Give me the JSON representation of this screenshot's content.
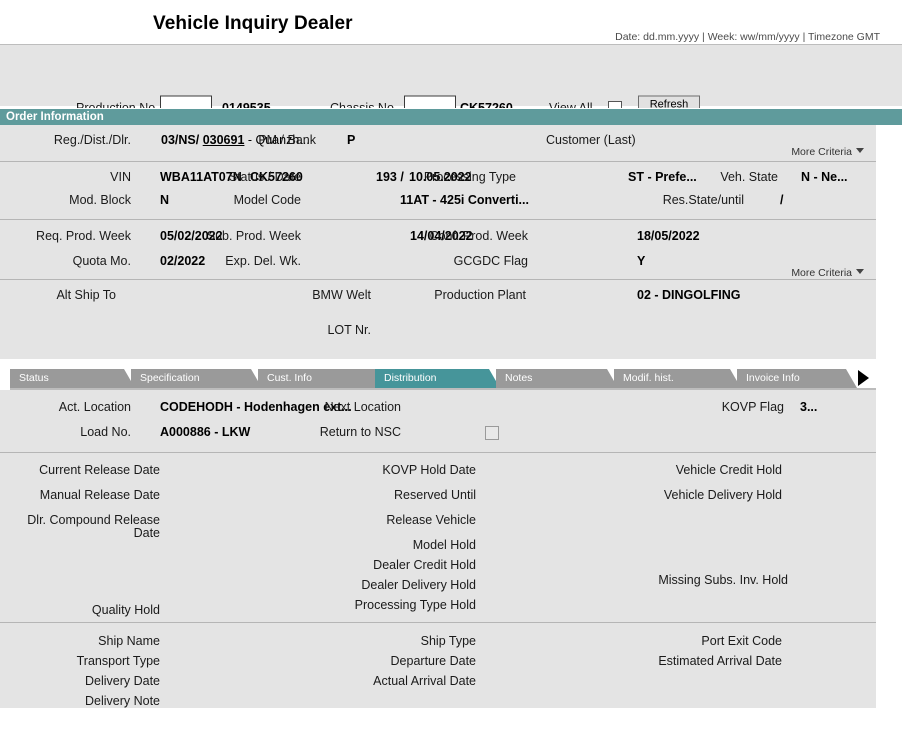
{
  "header": {
    "title": "Vehicle Inquiry Dealer",
    "meta": "Date: dd.mm.yyyy | Week: ww/mm/yyyy | Timezone GMT"
  },
  "search": {
    "production_no_label": "Production No.",
    "production_no_input": "",
    "production_no_value": "0149535",
    "chassis_no_label": "Chassis No.",
    "chassis_no_input": "",
    "chassis_no_value": "CK57260",
    "view_all_label": "View All",
    "view_all_checked": false,
    "refresh_label": "Refresh"
  },
  "order_information": {
    "section_title": "Order Information",
    "more_criteria_label": "More Criteria",
    "row1": {
      "reg_dist_dlr_label": "Reg./Dist./Dlr.",
      "reg_dist_dlr_prefix": "03/NS/",
      "reg_dist_dlr_link": "030691",
      "reg_dist_dlr_suffix": "- Quanzh...",
      "pm_bank_label": "PM / Bank",
      "pm_bank_value": "P",
      "customer_last_label": "Customer (Last)",
      "customer_last_value": ""
    },
    "row2": {
      "vin_label": "VIN",
      "vin_value": "WBA11AT07N",
      "vin_chassis": "CK57260",
      "status_date_label": "Status / Date",
      "status_value": "193 /",
      "status_date_value": "10.05.2022",
      "processing_type_label": "Processing Type",
      "processing_type_value": "ST - Prefe...",
      "veh_state_label": "Veh. State",
      "veh_state_value": "N - Ne..."
    },
    "row3": {
      "mod_block_label": "Mod. Block",
      "mod_block_value": "N",
      "model_code_label": "Model Code",
      "model_code_value": "11AT - 425i Converti...",
      "res_state_label": "Res.State/until",
      "res_state_value": "/"
    },
    "row4": {
      "req_prod_week_label": "Req. Prod. Week",
      "req_prod_week_value": "05/02/2022",
      "sub_prod_week_label": "Sub. Prod. Week",
      "sub_prod_week_value": "14/04/2022",
      "conf_prod_week_label": "Conf. Prod. Week",
      "conf_prod_week_value": "18/05/2022"
    },
    "row5": {
      "quota_mo_label": "Quota Mo.",
      "quota_mo_value": "02/2022",
      "exp_del_wk_label": "Exp. Del. Wk.",
      "exp_del_wk_value": "",
      "gcgdc_flag_label": "GCGDC Flag",
      "gcgdc_flag_value": "Y"
    },
    "row6": {
      "alt_ship_to_label": "Alt Ship To",
      "alt_ship_to_value": "",
      "bmw_welt_label": "BMW Welt",
      "bmw_welt_value": "",
      "production_plant_label": "Production Plant",
      "production_plant_value": "02 - DINGOLFING"
    },
    "row7": {
      "lot_nr_label": "LOT Nr.",
      "lot_nr_value": ""
    }
  },
  "tabs": [
    {
      "label": "Status",
      "active": false
    },
    {
      "label": "Specification",
      "active": false
    },
    {
      "label": "Cust. Info",
      "active": false
    },
    {
      "label": "Distribution",
      "active": true
    },
    {
      "label": "Notes",
      "active": false
    },
    {
      "label": "Modif. hist.",
      "active": false
    },
    {
      "label": "Invoice Info",
      "active": false
    }
  ],
  "distribution": {
    "act_location_label": "Act. Location",
    "act_location_value": "CODEHODH - Hodenhagen ext...",
    "next_location_label": "Next Location",
    "next_location_value": "",
    "kovp_flag_label": "KOVP Flag",
    "kovp_flag_value": "3...",
    "load_no_label": "Load No.",
    "load_no_value": "A000886 - LKW",
    "return_to_nsc_label": "Return to NSC",
    "return_to_nsc_checked": false,
    "holds": {
      "current_release_date_label": "Current Release Date",
      "current_release_date_value": "",
      "manual_release_date_label": "Manual Release Date",
      "manual_release_date_value": "",
      "dlr_compound_release_date_label_1": "Dlr. Compound Release",
      "dlr_compound_release_date_label_2": "Date",
      "dlr_compound_release_date_value": "",
      "quality_hold_label": "Quality Hold",
      "quality_hold_value": "",
      "kovp_hold_date_label": "KOVP Hold Date",
      "kovp_hold_date_value": "",
      "reserved_until_label": "Reserved Until",
      "reserved_until_value": "",
      "release_vehicle_label": "Release Vehicle",
      "release_vehicle_value": "",
      "model_hold_label": "Model Hold",
      "model_hold_value": "",
      "dealer_credit_hold_label": "Dealer Credit Hold",
      "dealer_credit_hold_value": "",
      "dealer_delivery_hold_label": "Dealer Delivery Hold",
      "dealer_delivery_hold_value": "",
      "processing_type_hold_label": "Processing Type Hold",
      "processing_type_hold_value": "",
      "vehicle_credit_hold_label": "Vehicle Credit Hold",
      "vehicle_credit_hold_value": "",
      "vehicle_delivery_hold_label": "Vehicle Delivery Hold",
      "vehicle_delivery_hold_value": "",
      "missing_subs_inv_hold_label": "Missing Subs. Inv. Hold",
      "missing_subs_inv_hold_value": ""
    },
    "shipping": {
      "ship_name_label": "Ship Name",
      "ship_name_value": "",
      "transport_type_label": "Transport Type",
      "transport_type_value": "",
      "delivery_date_label": "Delivery Date",
      "delivery_date_value": "",
      "delivery_note_label": "Delivery Note",
      "delivery_note_value": "",
      "ship_type_label": "Ship Type",
      "ship_type_value": "",
      "departure_date_label": "Departure Date",
      "departure_date_value": "",
      "actual_arrival_date_label": "Actual Arrival Date",
      "actual_arrival_date_value": "",
      "port_exit_code_label": "Port Exit Code",
      "port_exit_code_value": "",
      "estimated_arrival_date_label": "Estimated Arrival Date",
      "estimated_arrival_date_value": ""
    }
  },
  "colors": {
    "teal": "#5f9b9c",
    "tab_active": "#46959a",
    "tab_inactive": "#9a9a9a",
    "panel_bg": "#e4e4e4"
  }
}
